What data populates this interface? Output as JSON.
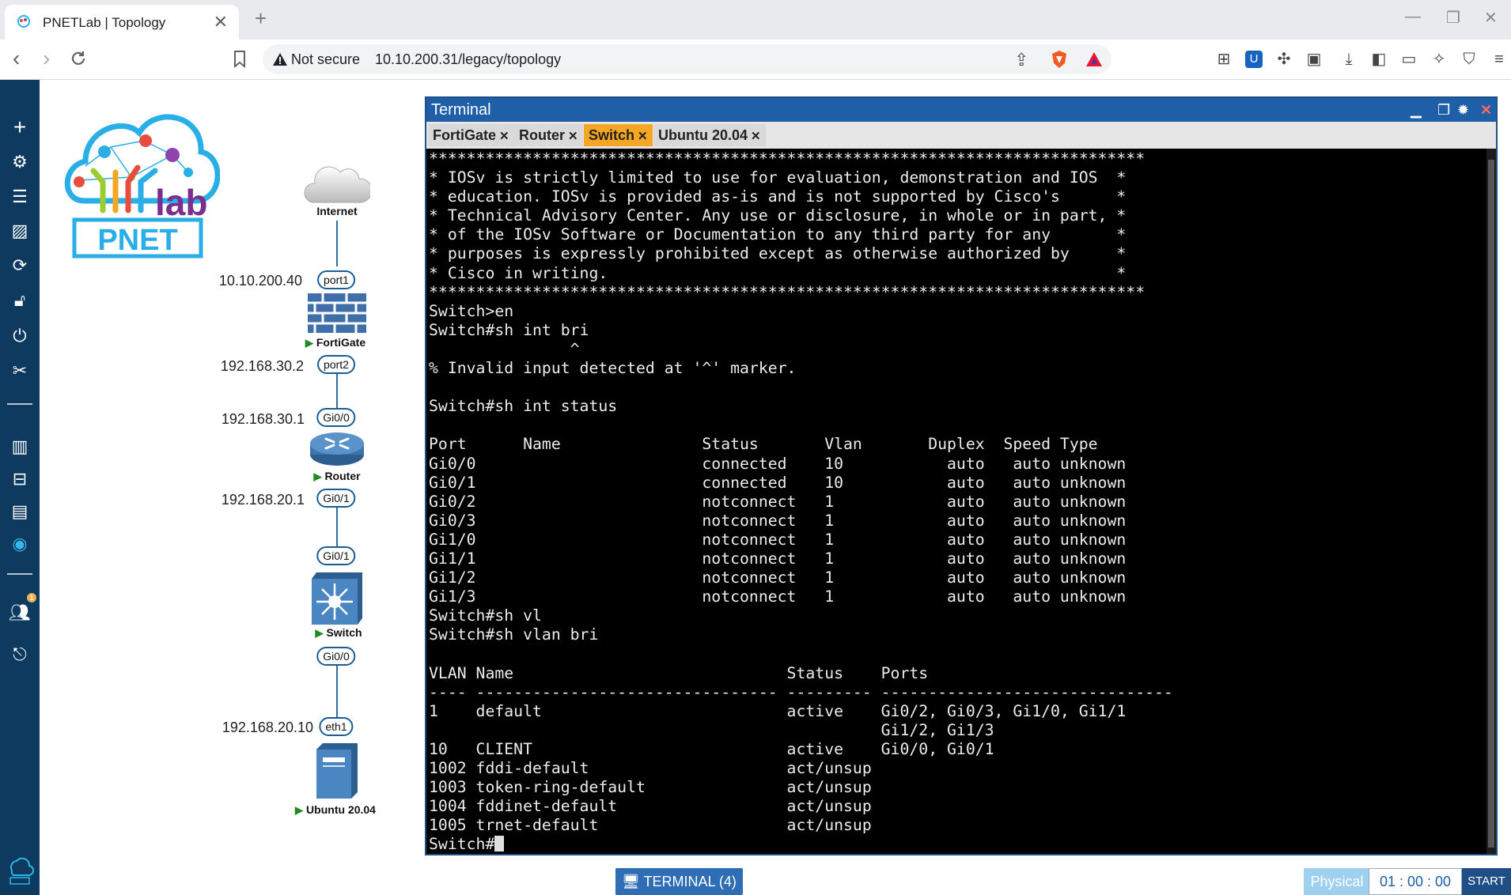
{
  "browser": {
    "tab_title": "PNETLab | Topology",
    "tab_close": "✕",
    "new_tab": "+",
    "security_label": "Not secure",
    "url": "10.10.200.31/legacy/topology"
  },
  "topology": {
    "nodes": [
      {
        "name": "Internet"
      },
      {
        "name": "FortiGate"
      },
      {
        "name": "Router"
      },
      {
        "name": "Switch"
      },
      {
        "name": "Ubuntu 20.04"
      }
    ],
    "ports": [
      "port1",
      "port2",
      "Gi0/0",
      "Gi0/1",
      "Gi0/1",
      "Gi0/0",
      "eth1"
    ],
    "ips": [
      "10.10.200.40",
      "192.168.30.2",
      "192.168.30.1",
      "192.168.20.1",
      "192.168.20.10"
    ]
  },
  "terminal": {
    "title": "Terminal",
    "tabs": [
      {
        "label": "FortiGate"
      },
      {
        "label": "Router"
      },
      {
        "label": "Switch"
      },
      {
        "label": "Ubuntu 20.04"
      }
    ],
    "active_tab": "Switch",
    "output": "****************************************************************************\n* IOSv is strictly limited to use for evaluation, demonstration and IOS  *\n* education. IOSv is provided as-is and is not supported by Cisco's      *\n* Technical Advisory Center. Any use or disclosure, in whole or in part, *\n* of the IOSv Software or Documentation to any third party for any       *\n* purposes is expressly prohibited except as otherwise authorized by     *\n* Cisco in writing.                                                      *\n****************************************************************************\nSwitch>en\nSwitch#sh int bri\n               ^\n% Invalid input detected at '^' marker.\n\nSwitch#sh int status\n\nPort      Name               Status       Vlan       Duplex  Speed Type\nGi0/0                        connected    10           auto   auto unknown\nGi0/1                        connected    10           auto   auto unknown\nGi0/2                        notconnect   1            auto   auto unknown\nGi0/3                        notconnect   1            auto   auto unknown\nGi1/0                        notconnect   1            auto   auto unknown\nGi1/1                        notconnect   1            auto   auto unknown\nGi1/2                        notconnect   1            auto   auto unknown\nGi1/3                        notconnect   1            auto   auto unknown\nSwitch#sh vl\nSwitch#sh vlan bri\n\nVLAN Name                             Status    Ports\n---- -------------------------------- --------- -------------------------------\n1    default                          active    Gi0/2, Gi0/3, Gi1/0, Gi1/1\n                                                Gi1/2, Gi1/3\n10   CLIENT                           active    Gi0/0, Gi0/1\n1002 fddi-default                     act/unsup\n1003 token-ring-default               act/unsup\n1004 fddinet-default                  act/unsup\n1005 trnet-default                    act/unsup\nSwitch#"
  },
  "bottom": {
    "terminal_count": "TERMINAL (4)",
    "mode": "Physical",
    "timer": "01 : 00 : 00",
    "start": "START"
  },
  "colors": {
    "sidebar": "#0e3a5f",
    "accent": "#1f5fa8",
    "active_tab": "#f5a623",
    "running": "#1f8a1f"
  }
}
